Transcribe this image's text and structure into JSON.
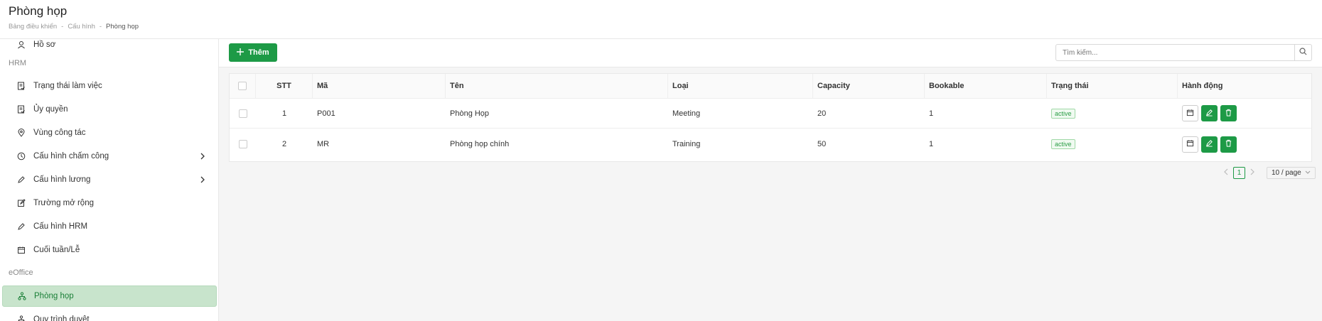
{
  "header": {
    "title": "Phòng họp",
    "breadcrumb": [
      "Bảng điều khiển",
      "Cấu hình",
      "Phòng họp"
    ],
    "separator": "-"
  },
  "sidebar": {
    "partial_top_item": "Hồ sơ",
    "groups": {
      "hrm": "HRM",
      "eoffice": "eOffice"
    },
    "items": [
      {
        "label": "Trạng thái làm việc",
        "icon": "document-check-icon"
      },
      {
        "label": "Ủy quyền",
        "icon": "document-check-icon"
      },
      {
        "label": "Vùng công tác",
        "icon": "location-pin-icon"
      },
      {
        "label": "Cấu hình chấm công",
        "icon": "clock-icon"
      },
      {
        "label": "Cấu hình lương",
        "icon": "pen-icon"
      },
      {
        "label": "Trường mở rộng",
        "icon": "edit-square-icon"
      },
      {
        "label": "Cấu hình HRM",
        "icon": "pen-icon"
      },
      {
        "label": "Cuối tuần/Lễ",
        "icon": "calendar-icon"
      },
      {
        "label": "Phòng họp",
        "icon": "org-chart-icon"
      },
      {
        "label": "Quy trình duyệt",
        "icon": "org-chart-icon"
      }
    ]
  },
  "toolbar": {
    "add_label": "Thêm",
    "search_placeholder": "Tìm kiếm..."
  },
  "table": {
    "columns": [
      "STT",
      "Mã",
      "Tên",
      "Loại",
      "Capacity",
      "Bookable",
      "Trạng thái",
      "Hành động"
    ],
    "rows": [
      {
        "stt": "1",
        "ma": "P001",
        "ten": "Phòng Họp",
        "loai": "Meeting",
        "capacity": "20",
        "bookable": "1",
        "status": "active"
      },
      {
        "stt": "2",
        "ma": "MR",
        "ten": "Phòng họp chính",
        "loai": "Training",
        "capacity": "50",
        "bookable": "1",
        "status": "active"
      }
    ]
  },
  "pagination": {
    "current": "1",
    "page_size": "10 / page"
  },
  "colors": {
    "primary": "#1d9a46",
    "active_bg": "#c8e4cc"
  }
}
